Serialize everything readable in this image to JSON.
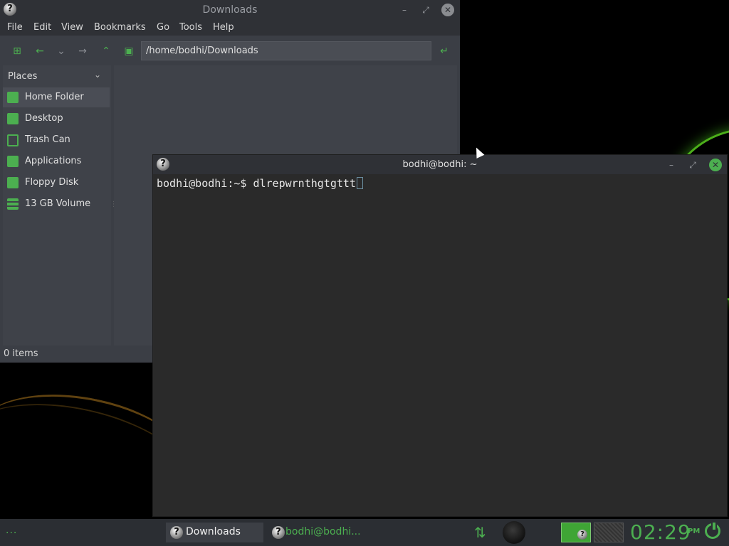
{
  "file_manager": {
    "title": "Downloads",
    "menu": [
      "File",
      "Edit",
      "View",
      "Bookmarks",
      "Go",
      "Tools",
      "Help"
    ],
    "path": "/home/bodhi/Downloads",
    "places_label": "Places",
    "places": [
      {
        "label": "Home Folder",
        "icon": "home-folder-icon"
      },
      {
        "label": "Desktop",
        "icon": "desktop-icon"
      },
      {
        "label": "Trash Can",
        "icon": "trash-icon"
      },
      {
        "label": "Applications",
        "icon": "applications-icon"
      },
      {
        "label": "Floppy Disk",
        "icon": "floppy-disk-icon"
      },
      {
        "label": "13 GB Volume",
        "icon": "drive-icon"
      }
    ],
    "status": "0 items"
  },
  "terminal": {
    "title": "bodhi@bodhi: ~",
    "prompt": "bodhi@bodhi:~$ ",
    "command": "dlrepwrnthgtgttt"
  },
  "taskbar": {
    "launcher": "...",
    "tasks": [
      {
        "label": "Downloads",
        "active": true
      },
      {
        "label": "bodhi@bodhi...",
        "active": false
      }
    ],
    "clock": "02:29",
    "ampm": "PM"
  },
  "colors": {
    "accent": "#4caf50",
    "window_bg": "#3b3e45",
    "titlebar_bg": "#2f3136",
    "terminal_bg": "#2a2a2a"
  }
}
